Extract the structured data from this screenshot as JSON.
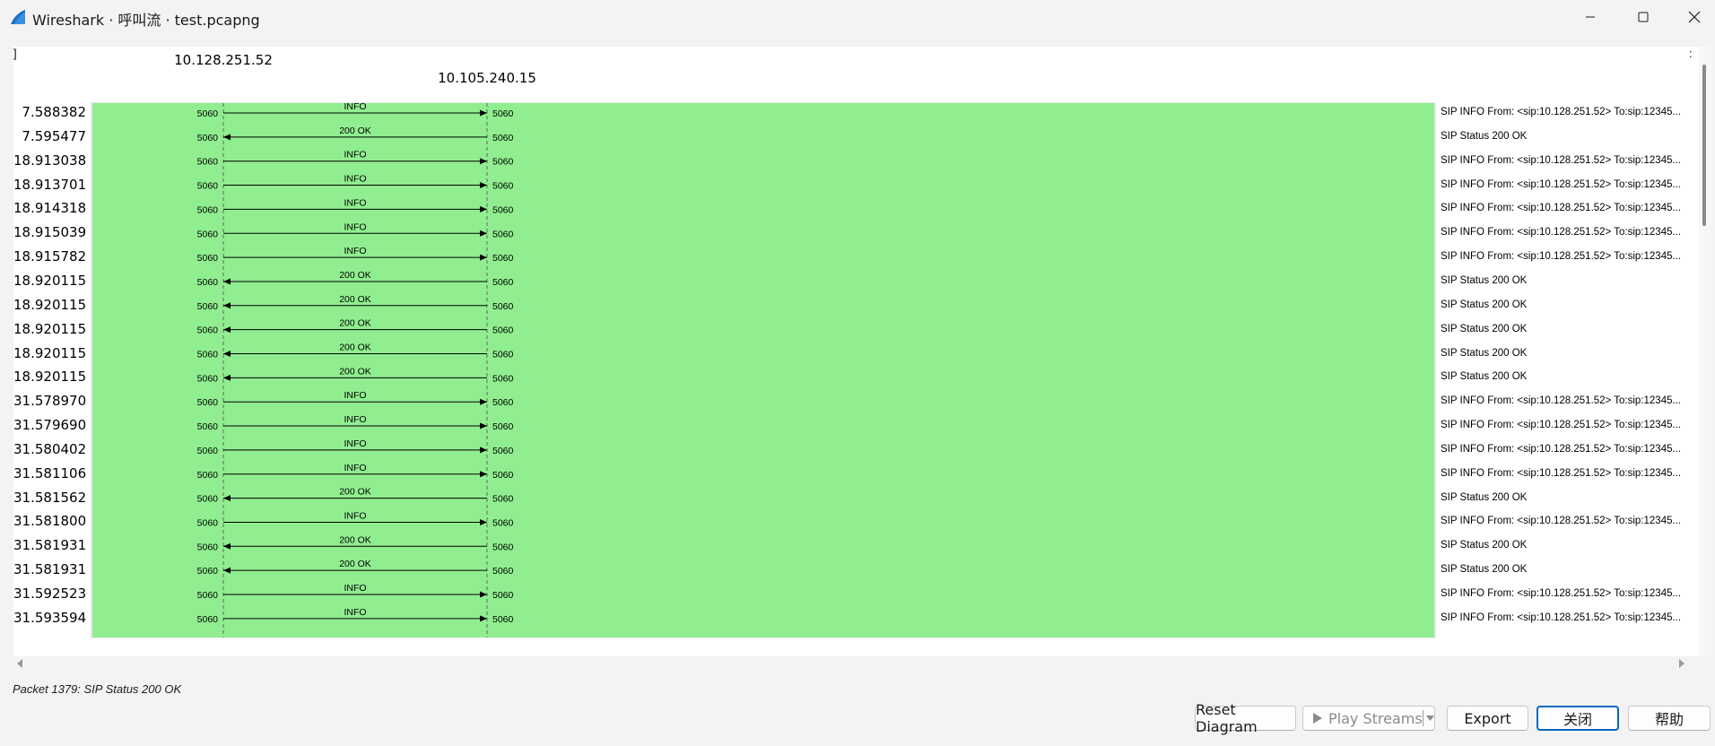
{
  "window": {
    "title": "Wireshark · 呼叫流 · test.pcapng",
    "controls": [
      "minimize-icon",
      "maximize-icon",
      "close-icon"
    ]
  },
  "diagram": {
    "hosts": [
      "10.128.251.52",
      "10.105.240.15"
    ],
    "left_corner_glyph": "]",
    "right_corner_glyph": ":",
    "fill_color": "#90ee90",
    "rows": [
      {
        "time": "7.588382",
        "label": "INFO",
        "dir": "right",
        "src_port": "5060",
        "dst_port": "5060",
        "comment": "SIP INFO From: <sip:10.128.251.52> To:sip:12345..."
      },
      {
        "time": "7.595477",
        "label": "200 OK",
        "dir": "left",
        "src_port": "5060",
        "dst_port": "5060",
        "comment": "SIP Status 200 OK"
      },
      {
        "time": "18.913038",
        "label": "INFO",
        "dir": "right",
        "src_port": "5060",
        "dst_port": "5060",
        "comment": "SIP INFO From: <sip:10.128.251.52> To:sip:12345..."
      },
      {
        "time": "18.913701",
        "label": "INFO",
        "dir": "right",
        "src_port": "5060",
        "dst_port": "5060",
        "comment": "SIP INFO From: <sip:10.128.251.52> To:sip:12345..."
      },
      {
        "time": "18.914318",
        "label": "INFO",
        "dir": "right",
        "src_port": "5060",
        "dst_port": "5060",
        "comment": "SIP INFO From: <sip:10.128.251.52> To:sip:12345..."
      },
      {
        "time": "18.915039",
        "label": "INFO",
        "dir": "right",
        "src_port": "5060",
        "dst_port": "5060",
        "comment": "SIP INFO From: <sip:10.128.251.52> To:sip:12345..."
      },
      {
        "time": "18.915782",
        "label": "INFO",
        "dir": "right",
        "src_port": "5060",
        "dst_port": "5060",
        "comment": "SIP INFO From: <sip:10.128.251.52> To:sip:12345..."
      },
      {
        "time": "18.920115",
        "label": "200 OK",
        "dir": "left",
        "src_port": "5060",
        "dst_port": "5060",
        "comment": "SIP Status 200 OK"
      },
      {
        "time": "18.920115",
        "label": "200 OK",
        "dir": "left",
        "src_port": "5060",
        "dst_port": "5060",
        "comment": "SIP Status 200 OK"
      },
      {
        "time": "18.920115",
        "label": "200 OK",
        "dir": "left",
        "src_port": "5060",
        "dst_port": "5060",
        "comment": "SIP Status 200 OK"
      },
      {
        "time": "18.920115",
        "label": "200 OK",
        "dir": "left",
        "src_port": "5060",
        "dst_port": "5060",
        "comment": "SIP Status 200 OK"
      },
      {
        "time": "18.920115",
        "label": "200 OK",
        "dir": "left",
        "src_port": "5060",
        "dst_port": "5060",
        "comment": "SIP Status 200 OK"
      },
      {
        "time": "31.578970",
        "label": "INFO",
        "dir": "right",
        "src_port": "5060",
        "dst_port": "5060",
        "comment": "SIP INFO From: <sip:10.128.251.52> To:sip:12345..."
      },
      {
        "time": "31.579690",
        "label": "INFO",
        "dir": "right",
        "src_port": "5060",
        "dst_port": "5060",
        "comment": "SIP INFO From: <sip:10.128.251.52> To:sip:12345..."
      },
      {
        "time": "31.580402",
        "label": "INFO",
        "dir": "right",
        "src_port": "5060",
        "dst_port": "5060",
        "comment": "SIP INFO From: <sip:10.128.251.52> To:sip:12345..."
      },
      {
        "time": "31.581106",
        "label": "INFO",
        "dir": "right",
        "src_port": "5060",
        "dst_port": "5060",
        "comment": "SIP INFO From: <sip:10.128.251.52> To:sip:12345..."
      },
      {
        "time": "31.581562",
        "label": "200 OK",
        "dir": "left",
        "src_port": "5060",
        "dst_port": "5060",
        "comment": "SIP Status 200 OK"
      },
      {
        "time": "31.581800",
        "label": "INFO",
        "dir": "right",
        "src_port": "5060",
        "dst_port": "5060",
        "comment": "SIP INFO From: <sip:10.128.251.52> To:sip:12345..."
      },
      {
        "time": "31.581931",
        "label": "200 OK",
        "dir": "left",
        "src_port": "5060",
        "dst_port": "5060",
        "comment": "SIP Status 200 OK"
      },
      {
        "time": "31.581931",
        "label": "200 OK",
        "dir": "left",
        "src_port": "5060",
        "dst_port": "5060",
        "comment": "SIP Status 200 OK"
      },
      {
        "time": "31.592523",
        "label": "INFO",
        "dir": "right",
        "src_port": "5060",
        "dst_port": "5060",
        "comment": "SIP INFO From: <sip:10.128.251.52> To:sip:12345..."
      },
      {
        "time": "31.593594",
        "label": "INFO",
        "dir": "right",
        "src_port": "5060",
        "dst_port": "5060",
        "comment": "SIP INFO From: <sip:10.128.251.52> To:sip:12345..."
      }
    ]
  },
  "status": {
    "text": "Packet 1379: SIP Status 200 OK"
  },
  "buttons": {
    "reset": "Reset Diagram",
    "play": "Play Streams",
    "export": "Export",
    "close": "关闭",
    "help": "帮助"
  }
}
